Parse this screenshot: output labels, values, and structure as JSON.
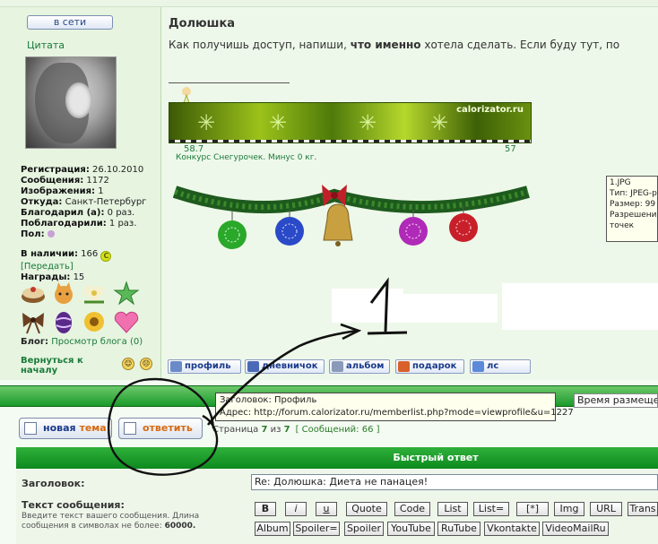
{
  "topbar_text": "",
  "profile": {
    "online_label": "в сети",
    "quote_label": "Цитата",
    "stats": [
      {
        "label": "Регистрация:",
        "value": "26.10.2010"
      },
      {
        "label": "Сообщения:",
        "value": "1172"
      },
      {
        "label": "Изображения:",
        "value": "1"
      },
      {
        "label": "Откуда:",
        "value": "Санкт-Петербург"
      },
      {
        "label": "Благодарил (а):",
        "value": "0 раз."
      },
      {
        "label": "Поблагодарили:",
        "value": "1 раз."
      },
      {
        "label": "Пол:",
        "value": ""
      }
    ],
    "available_label": "В наличии:",
    "available_value": "166",
    "coin_symbol": "C",
    "transfer_link": "[Передать]",
    "awards_label": "Награды:",
    "awards_value": "15",
    "blog_label": "Блог:",
    "blog_link": "Просмотр блога (0)",
    "back_link": "Вернуться к началу"
  },
  "post": {
    "title": "Долюшка",
    "text_before": "Как получишь доступ, напиши,",
    "text_bold": "что именно",
    "text_after": "хотела сделать. Если буду тут, по",
    "ticker_brand": "calorizator.ru",
    "ticker_start": "58.7",
    "ticker_end": "57",
    "ticker_caption": "Конкурс Снегурочек. Минус 0 кг."
  },
  "image_tooltip": {
    "lines": [
      "1.JPG",
      "Тип: JPEG-р",
      "Размер: 99",
      "Разрешение",
      "точек"
    ]
  },
  "annotations": {
    "number": "1",
    "ink_color": "#111111"
  },
  "post_buttons": [
    {
      "label": "профиль",
      "icon": "profile-icon"
    },
    {
      "label": "дневничок",
      "icon": "diary-icon"
    },
    {
      "label": "альбом",
      "icon": "album-icon"
    },
    {
      "label": "подарок",
      "icon": "gift-icon"
    },
    {
      "label": "лс",
      "icon": "pm-icon"
    }
  ],
  "sort_select": "Время размещения",
  "link_tooltip": {
    "line1": "Заголовок: Профиль",
    "line2": "Адрес: http://forum.calorizator.ru/memberlist.php?mode=viewprofile&u=1227"
  },
  "actions": {
    "new_topic_prefix": "новая ",
    "new_topic_suffix": "тема",
    "reply": "ответить"
  },
  "pager": {
    "page_word": "Страница",
    "current": "7",
    "of_word": "из",
    "total": "7",
    "messages": "[ Сообщений: 66 ]"
  },
  "quick_reply": {
    "title": "Быстрый ответ",
    "subject_label": "Заголовок:",
    "subject_value": "Re: Долюшка: Диета не панацея!",
    "message_label": "Текст сообщения:",
    "hint_text": "Введите текст вашего сообщения. Длина сообщения в символах не более:",
    "hint_limit": "60000.",
    "bbcode_row1": [
      "B",
      "i",
      "u",
      "Quote",
      "Code",
      "List",
      "List=",
      "[*]",
      "Img",
      "URL",
      "Trans"
    ],
    "bbcode_row2": [
      "Album",
      "Spoiler=",
      "Spoiler",
      "YouTube",
      "RuTube",
      "Vkontakte",
      "VideoMailRu"
    ]
  },
  "colors": {
    "green_bar": "#1a9a2a",
    "link_green": "#1a7a3a",
    "button_blue": "#1a3a8a",
    "reply_orange": "#d86a10"
  }
}
